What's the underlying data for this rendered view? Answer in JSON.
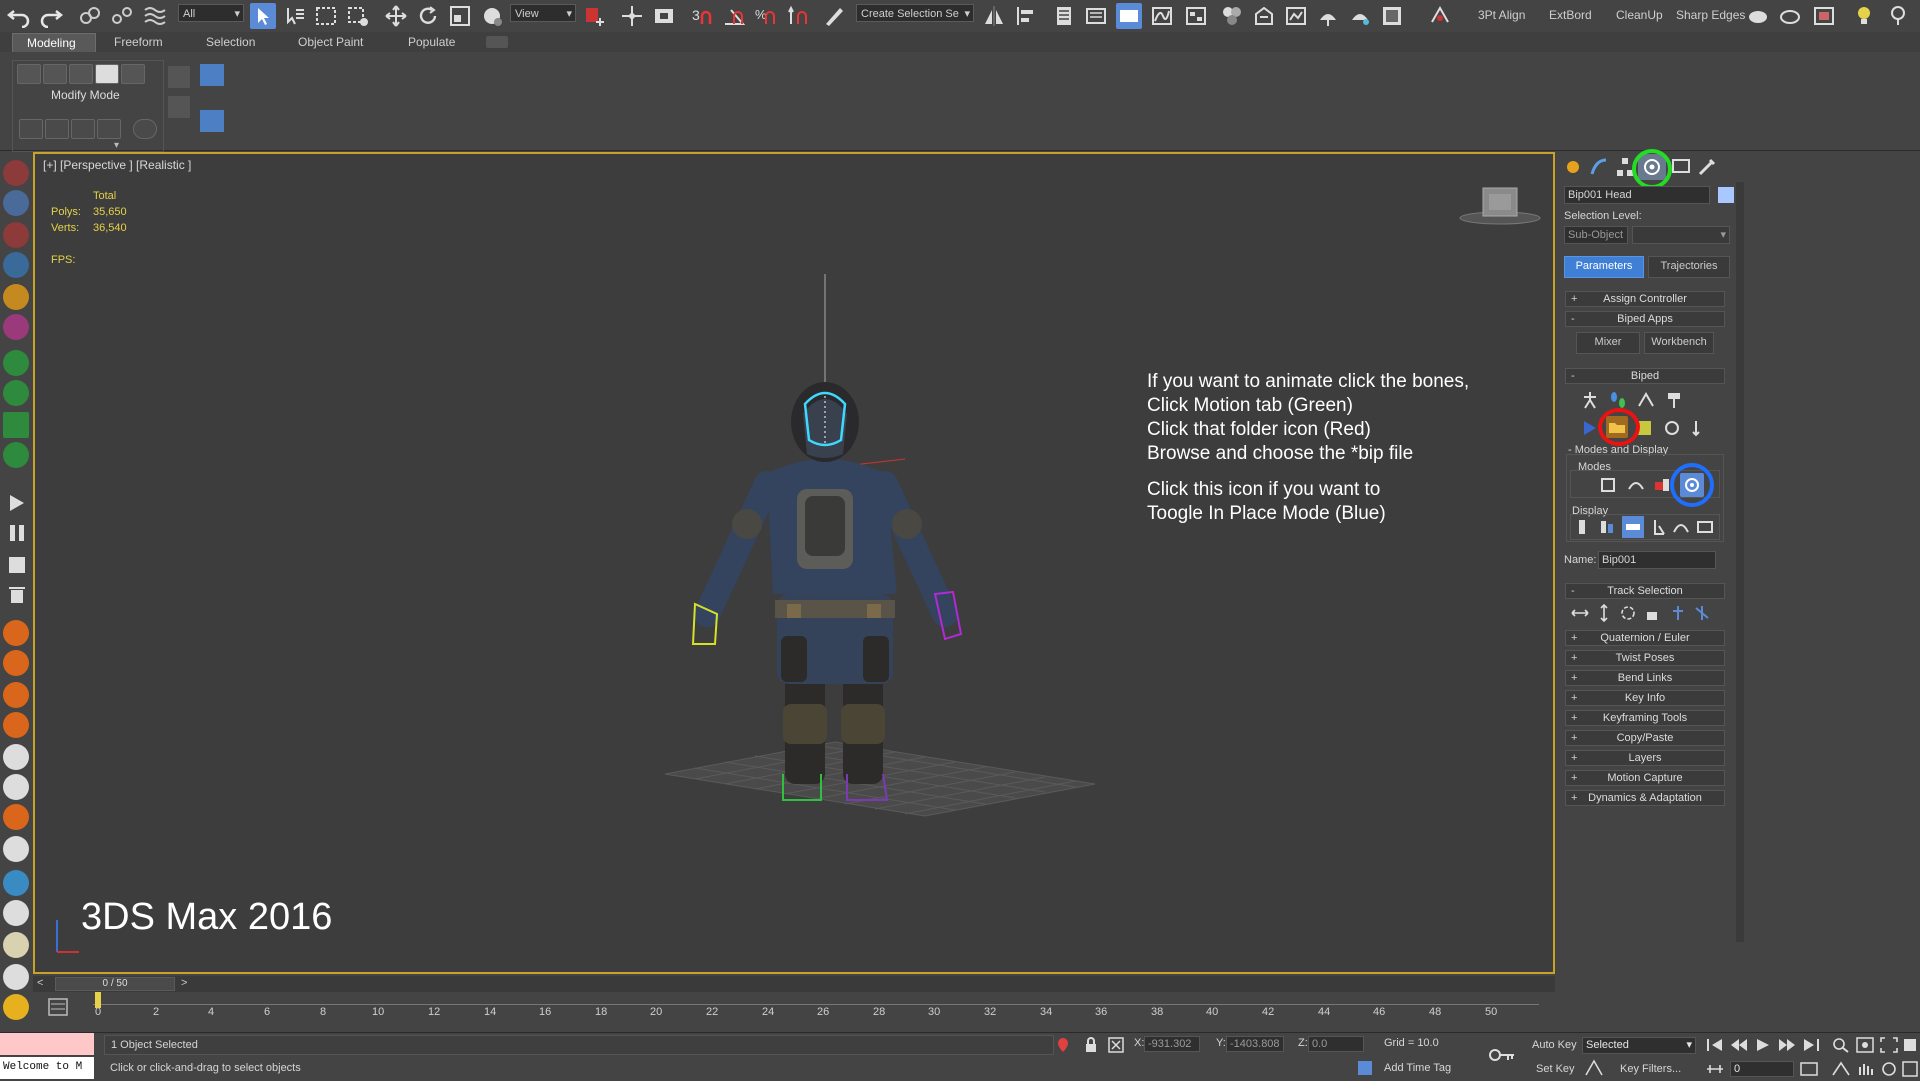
{
  "toolbar": {
    "filter_value": "All",
    "refcoord_value": "View",
    "named_selection_placeholder": "Create Selection Se",
    "plugins": [
      "3Pt Align",
      "ExtBord",
      "CleanUp",
      "Sharp Edges"
    ]
  },
  "ribbon": {
    "tabs": [
      "Modeling",
      "Freeform",
      "Selection",
      "Object Paint",
      "Populate"
    ],
    "panel_label": "Modify Mode"
  },
  "viewport": {
    "label": "[+] [Perspective ] [Realistic ]",
    "stats": {
      "total_label": "Total",
      "polys_label": "Polys:",
      "polys_value": "35,650",
      "verts_label": "Verts:",
      "verts_value": "36,540",
      "fps_label": "FPS:"
    },
    "watermark": "3DS Max 2016",
    "annotation_lines_1": [
      "If you want to animate click the bones,",
      "Click Motion tab (Green)",
      "Click that folder icon (Red)",
      "Browse and choose the *bip file"
    ],
    "annotation_lines_2": [
      "Click this icon if you want to",
      "Toogle In Place Mode (Blue)"
    ]
  },
  "command_panel": {
    "object_name": "Bip001 Head",
    "selection_level_label": "Selection Level:",
    "sub_object_label": "Sub-Object",
    "tabs": {
      "parameters": "Parameters",
      "trajectories": "Trajectories"
    },
    "assign_controller": "Assign Controller",
    "biped_apps": "Biped Apps",
    "mixer": "Mixer",
    "workbench": "Workbench",
    "biped": "Biped",
    "modes_and_display": "Modes and Display",
    "modes_label": "Modes",
    "display_label": "Display",
    "name_label": "Name:",
    "name_value": "Bip001",
    "track_selection": "Track Selection",
    "rollouts": [
      "Quaternion / Euler",
      "Twist Poses",
      "Bend Links",
      "Key Info",
      "Keyframing Tools",
      "Copy/Paste",
      "Layers",
      "Motion Capture",
      "Dynamics & Adaptation"
    ]
  },
  "timeline": {
    "frame_readout": "0 / 50",
    "ticks": [
      "0",
      "2",
      "4",
      "6",
      "8",
      "10",
      "12",
      "14",
      "16",
      "18",
      "20",
      "22",
      "24",
      "26",
      "28",
      "30",
      "32",
      "34",
      "36",
      "38",
      "40",
      "42",
      "44",
      "46",
      "48",
      "50"
    ]
  },
  "status": {
    "listener": "Welcome to M",
    "selected_text": "1 Object Selected",
    "prompt_text": "Click or click-and-drag to select objects",
    "x_label": "X:",
    "x_value": "-931.302",
    "y_label": "Y:",
    "y_value": "-1403.808",
    "z_label": "Z:",
    "z_value": "0.0",
    "grid": "Grid = 10.0",
    "add_time_tag": "Add Time Tag",
    "auto_key": "Auto Key",
    "set_key": "Set Key",
    "selected_dropdown": "Selected",
    "key_filters": "Key Filters...",
    "frame_field": "0"
  },
  "colors": {
    "highlight_green": "#22dd22",
    "highlight_red": "#ee1111",
    "highlight_blue": "#1f6fff",
    "viewport_border": "#c9a227",
    "stats_yellow": "#e6d24a"
  }
}
